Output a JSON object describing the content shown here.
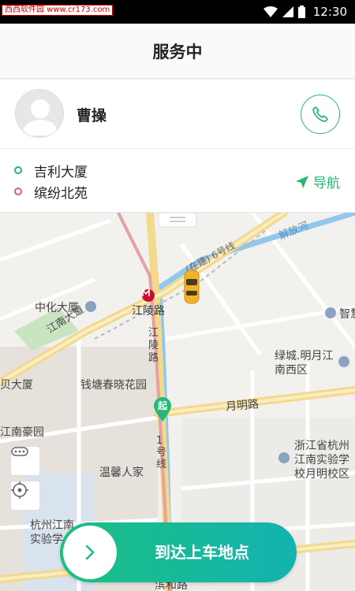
{
  "statusbar": {
    "watermark": "西西软件园 www.cr173.com",
    "time": "12:30"
  },
  "header": {
    "title": "服务中"
  },
  "driver": {
    "name": "曹操"
  },
  "route": {
    "start": "吉利大厦",
    "end": "缤纷北苑",
    "nav_label": "导航"
  },
  "map": {
    "labels": {
      "zhonghua": "中化大厦",
      "jiangling_road": "江陵路",
      "jiangling_vertical": "江陵路",
      "jiangnan_avenue": "江南大道",
      "bei_mansion": "贝大厦",
      "qiantang": "钱塘春晓花园",
      "jiangnan_haoyuan": "江南豪园",
      "wenxin": "温馨人家",
      "hangzhou_jn": "杭州江南实验学",
      "binhe": "滨和路",
      "jiefang_river": "解放河",
      "line6": "(在建) 6号线",
      "zhihui": "智慧",
      "lvcheng": "绿城.明月江南西区",
      "yueming_road": "月明路",
      "line1": "1号线",
      "zhejiang_school": "浙江省杭州江南实验学校月明校区",
      "start_marker": "起"
    }
  },
  "action": {
    "arrive_label": "到达上车地点"
  },
  "colors": {
    "accent": "#2bb673",
    "start_dot": "#25b87a",
    "end_dot": "#e35d6a",
    "action_gradient_start": "#1cbf83",
    "action_gradient_end": "#13b3b0"
  },
  "icons": {
    "call": "phone-icon",
    "nav": "navigation-arrow-icon",
    "more": "more-dots-icon",
    "locate": "locate-icon",
    "arrive": "chevron-right-icon",
    "car": "taxi-car-icon",
    "metro": "metro-icon"
  }
}
